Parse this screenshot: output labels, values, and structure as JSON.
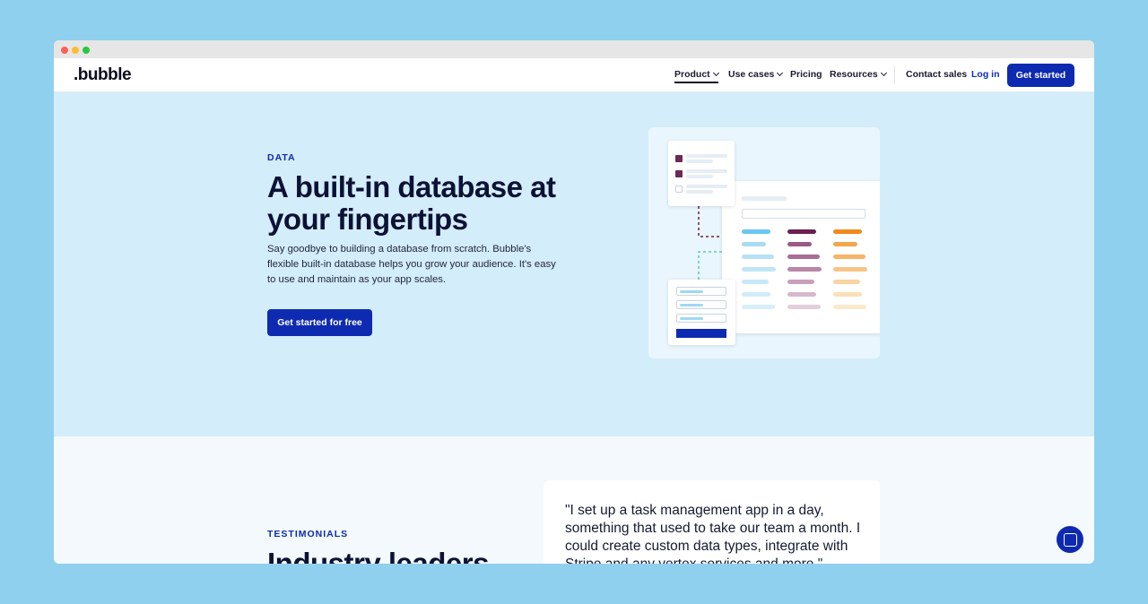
{
  "nav": {
    "logo": ".bubble",
    "items": [
      "Product",
      "Use cases",
      "Pricing",
      "Resources"
    ],
    "contact_sales": "Contact sales",
    "login": "Log in",
    "cta": "Get started"
  },
  "hero": {
    "eyebrow": "DATA",
    "title": "A built-in database at your fingertips",
    "description": "Say goodbye to building a database from scratch. Bubble's flexible built-in database helps you grow your audience. It's easy to use and maintain as your app scales.",
    "cta": "Get started for free"
  },
  "testimonials": {
    "eyebrow": "TESTIMONIALS",
    "title": "Industry leaders",
    "quote": "\"I set up a task management app in a day, something that used to take our team a month. I could create custom data types, integrate with Stripe and any vertex services and more.\""
  },
  "colors": {
    "brand_blue": "#0d2ab0",
    "hero_bg": "#d3edfb",
    "background": "#8fd0ee"
  },
  "icons": {
    "chat": "chat-icon",
    "chevron": "chevron-down-icon"
  }
}
